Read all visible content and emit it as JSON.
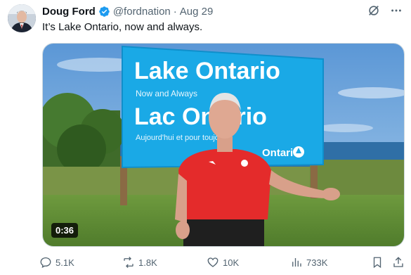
{
  "tweet": {
    "author_name": "Doug Ford",
    "handle": "@fordnation",
    "separator": "·",
    "date": "Aug 29",
    "text": "It’s Lake Ontario, now and always."
  },
  "media": {
    "duration": "0:36",
    "sign_text": {
      "line1": "Lake Ontario",
      "line2": "Now and Always",
      "line3": "Lac Ontario",
      "line4": "Aujourd'hui et pour toujours",
      "brand": "Ontario"
    }
  },
  "actions": {
    "replies": "5.1K",
    "reposts": "1.8K",
    "likes": "10K",
    "views": "733K"
  },
  "icons": {
    "verified": "verified-badge-icon",
    "grok": "grok-icon",
    "more": "more-icon",
    "reply": "reply-icon",
    "repost": "repost-icon",
    "like": "like-icon",
    "views": "views-icon",
    "bookmark": "bookmark-icon",
    "share": "share-icon"
  },
  "colors": {
    "accent": "#1d9bf0",
    "text_primary": "#0f1419",
    "text_secondary": "#536471",
    "sign_blue": "#1aa9e6",
    "shirt_red": "#e42b2b"
  }
}
